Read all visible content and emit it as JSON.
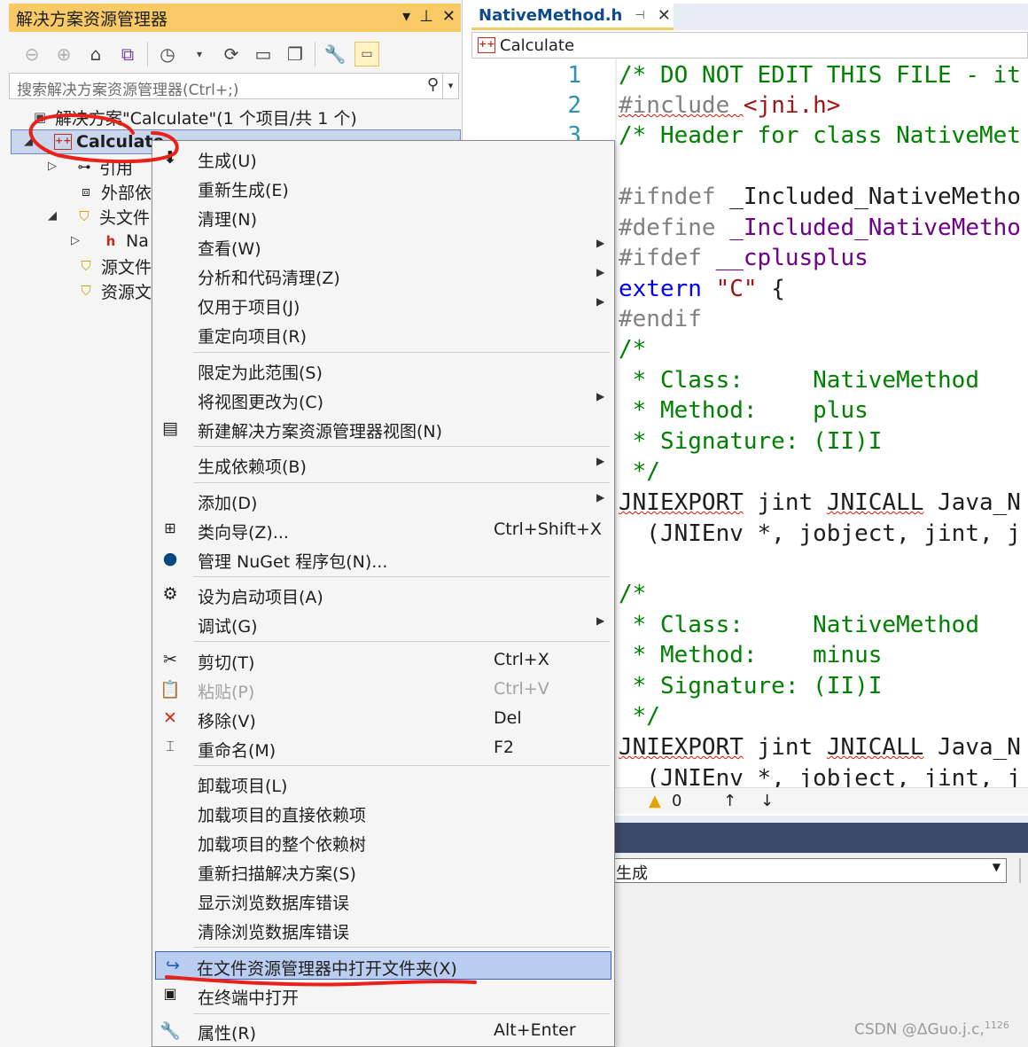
{
  "solution_explorer": {
    "title": "解决方案资源管理器",
    "search_placeholder": "搜索解决方案资源管理器(Ctrl+;)",
    "tree": {
      "solution": "解决方案\"Calculate\"(1 个项目/共 1 个)",
      "project": "Calculate",
      "references": "引用",
      "external": "外部依",
      "headers": "头文件",
      "header_file": "Na",
      "sources": "源文件",
      "resources": "资源文"
    }
  },
  "editor": {
    "tab": "NativeMethod.h",
    "nav_scope": "Calculate",
    "line_numbers": [
      "1",
      "2",
      "3"
    ],
    "lines": {
      "l1": "/* DO NOT EDIT THIS FILE - it",
      "l2_pp": "#include ",
      "l2_str": "<jni.h>",
      "l3": "/* Header for class NativeMet",
      "l5_pp": "#ifndef ",
      "l5_mac": "_Included_NativeMetho",
      "l6_pp": "#define ",
      "l6_mac": "_Included_NativeMetho",
      "l7_pp": "#ifdef ",
      "l7_mac": "__cplusplus",
      "l8_kw": "extern ",
      "l8_str": "\"C\"",
      "l8_txt": " {",
      "l9": "#endif",
      "l10": "/*",
      "l11": " * Class:     NativeMethod",
      "l12": " * Method:    plus",
      "l13": " * Signature: (II)I",
      "l14": " */",
      "l15_a": "JNIEXPORT",
      "l15_b": " jint ",
      "l15_c": "JNICALL",
      "l15_d": " Java_N",
      "l16": "  (JNIEnv *, jobject, jint, j",
      "l18": "/*",
      "l19": " * Class:     NativeMethod",
      "l20": " * Method:    minus",
      "l21": " * Signature: (II)I",
      "l22": " */",
      "l23_a": "JNIEXPORT",
      "l23_b": " jint ",
      "l23_c": "JNICALL",
      "l23_d": " Java_N",
      "l24": "  (JNIEnv *, jobject, jint, j"
    },
    "status": {
      "warnings": "0"
    }
  },
  "output": {
    "source": "生成"
  },
  "context_menu": {
    "items": [
      {
        "label": "生成(U)"
      },
      {
        "label": "重新生成(E)"
      },
      {
        "label": "清理(N)"
      },
      {
        "label": "查看(W)"
      },
      {
        "label": "分析和代码清理(Z)"
      },
      {
        "label": "仅用于项目(J)"
      },
      {
        "label": "重定向项目(R)"
      },
      {
        "label": "限定为此范围(S)"
      },
      {
        "label": "将视图更改为(C)"
      },
      {
        "label": "新建解决方案资源管理器视图(N)"
      },
      {
        "label": "生成依赖项(B)"
      },
      {
        "label": "添加(D)"
      },
      {
        "label": "类向导(Z)...",
        "shortcut": "Ctrl+Shift+X"
      },
      {
        "label": "管理 NuGet 程序包(N)..."
      },
      {
        "label": "设为启动项目(A)"
      },
      {
        "label": "调试(G)"
      },
      {
        "label": "剪切(T)",
        "shortcut": "Ctrl+X"
      },
      {
        "label": "粘贴(P)",
        "shortcut": "Ctrl+V"
      },
      {
        "label": "移除(V)",
        "shortcut": "Del"
      },
      {
        "label": "重命名(M)",
        "shortcut": "F2"
      },
      {
        "label": "卸载项目(L)"
      },
      {
        "label": "加载项目的直接依赖项"
      },
      {
        "label": "加载项目的整个依赖树"
      },
      {
        "label": "重新扫描解决方案(S)"
      },
      {
        "label": "显示浏览数据库错误"
      },
      {
        "label": "清除浏览数据库错误"
      },
      {
        "label": "在文件资源管理器中打开文件夹(X)"
      },
      {
        "label": "在终端中打开"
      },
      {
        "label": "属性(R)",
        "shortcut": "Alt+Enter"
      }
    ]
  },
  "watermark": {
    "text": "CSDN @ΔGuo.j.c,",
    "sup": "1126"
  },
  "colors": {
    "title_bar": "#f7ca66",
    "highlight": "#b9cdf0",
    "annotation": "#e8211b",
    "comment": "#008000",
    "macro": "#6f008a",
    "keyword": "#0000ff",
    "string": "#a31515"
  }
}
